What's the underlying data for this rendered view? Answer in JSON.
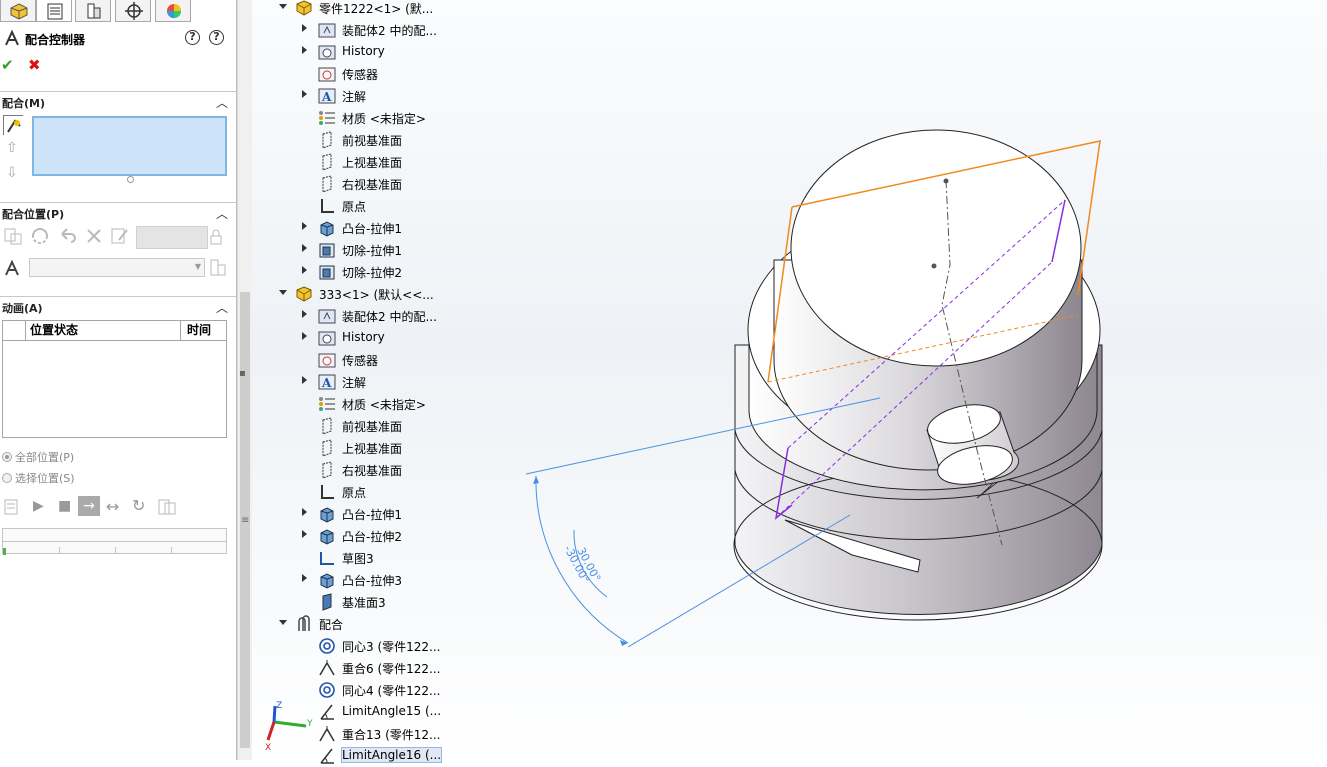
{
  "pm": {
    "tabs": [
      "feature-manager-icon",
      "property-manager-icon",
      "configuration-manager-icon",
      "dimxpert-icon",
      "display-manager-icon"
    ],
    "title": "配合控制器",
    "sections": {
      "mates": "配合(M)",
      "mate_positions": "配合位置(P)",
      "animation": "动画(A)"
    },
    "anim_table": {
      "col_position": "位置状态",
      "col_time": "时间"
    },
    "radio_all": "全部位置(P)",
    "radio_select": "选择位置(S)"
  },
  "tree": [
    {
      "label": "零件1222<1> (默...",
      "icon": "part-yellow",
      "indent": 0,
      "expand": "open"
    },
    {
      "label": "装配体2 中的配...",
      "icon": "mates-folder",
      "indent": 1,
      "expand": "closed"
    },
    {
      "label": "History",
      "icon": "history",
      "indent": 1,
      "expand": "closed"
    },
    {
      "label": "传感器",
      "icon": "sensor",
      "indent": 1,
      "expand": "none"
    },
    {
      "label": "注解",
      "icon": "annotation",
      "indent": 1,
      "expand": "closed"
    },
    {
      "label": "材质 <未指定>",
      "icon": "material",
      "indent": 1,
      "expand": "none"
    },
    {
      "label": "前视基准面",
      "icon": "plane",
      "indent": 1,
      "expand": "none"
    },
    {
      "label": "上视基准面",
      "icon": "plane",
      "indent": 1,
      "expand": "none"
    },
    {
      "label": "右视基准面",
      "icon": "plane",
      "indent": 1,
      "expand": "none"
    },
    {
      "label": "原点",
      "icon": "origin",
      "indent": 1,
      "expand": "none"
    },
    {
      "label": "凸台-拉伸1",
      "icon": "extrude",
      "indent": 1,
      "expand": "closed"
    },
    {
      "label": "切除-拉伸1",
      "icon": "cut",
      "indent": 1,
      "expand": "closed"
    },
    {
      "label": "切除-拉伸2",
      "icon": "cut",
      "indent": 1,
      "expand": "closed"
    },
    {
      "label": "333<1> (默认<<...",
      "icon": "part-yellow",
      "indent": 0,
      "expand": "open"
    },
    {
      "label": "装配体2 中的配...",
      "icon": "mates-folder",
      "indent": 1,
      "expand": "closed"
    },
    {
      "label": "History",
      "icon": "history",
      "indent": 1,
      "expand": "closed"
    },
    {
      "label": "传感器",
      "icon": "sensor",
      "indent": 1,
      "expand": "none"
    },
    {
      "label": "注解",
      "icon": "annotation",
      "indent": 1,
      "expand": "closed"
    },
    {
      "label": "材质 <未指定>",
      "icon": "material",
      "indent": 1,
      "expand": "none"
    },
    {
      "label": "前视基准面",
      "icon": "plane",
      "indent": 1,
      "expand": "none"
    },
    {
      "label": "上视基准面",
      "icon": "plane",
      "indent": 1,
      "expand": "none"
    },
    {
      "label": "右视基准面",
      "icon": "plane",
      "indent": 1,
      "expand": "none"
    },
    {
      "label": "原点",
      "icon": "origin",
      "indent": 1,
      "expand": "none"
    },
    {
      "label": "凸台-拉伸1",
      "icon": "extrude",
      "indent": 1,
      "expand": "closed"
    },
    {
      "label": "凸台-拉伸2",
      "icon": "extrude",
      "indent": 1,
      "expand": "closed"
    },
    {
      "label": "草图3",
      "icon": "sketch",
      "indent": 1,
      "expand": "none"
    },
    {
      "label": "凸台-拉伸3",
      "icon": "extrude",
      "indent": 1,
      "expand": "closed"
    },
    {
      "label": "基准面3",
      "icon": "plane-blue",
      "indent": 1,
      "expand": "none"
    },
    {
      "label": "配合",
      "icon": "mates",
      "indent": 0,
      "expand": "open"
    },
    {
      "label": "同心3 (零件122...",
      "icon": "concentric",
      "indent": 1,
      "expand": "none"
    },
    {
      "label": "重合6 (零件122...",
      "icon": "coincident",
      "indent": 1,
      "expand": "none"
    },
    {
      "label": "同心4 (零件122...",
      "icon": "concentric",
      "indent": 1,
      "expand": "none"
    },
    {
      "label": "LimitAngle15 (...",
      "icon": "limit-angle",
      "indent": 1,
      "expand": "none"
    },
    {
      "label": "重合13 (零件12...",
      "icon": "coincident",
      "indent": 1,
      "expand": "none"
    },
    {
      "label": "LimitAngle16 (...",
      "icon": "limit-angle",
      "indent": 1,
      "expand": "none",
      "selected": true
    }
  ],
  "viewport": {
    "dim_upper": "30.00°",
    "dim_lower": "-30.00°",
    "triad": {
      "x": "X",
      "y": "Y",
      "z": "Z"
    }
  },
  "colors": {
    "dimension": "#4a90e2",
    "plane_orange": "#f08a1c",
    "plane_purple": "#8a2be2",
    "mate_box": "#cde3f7"
  }
}
